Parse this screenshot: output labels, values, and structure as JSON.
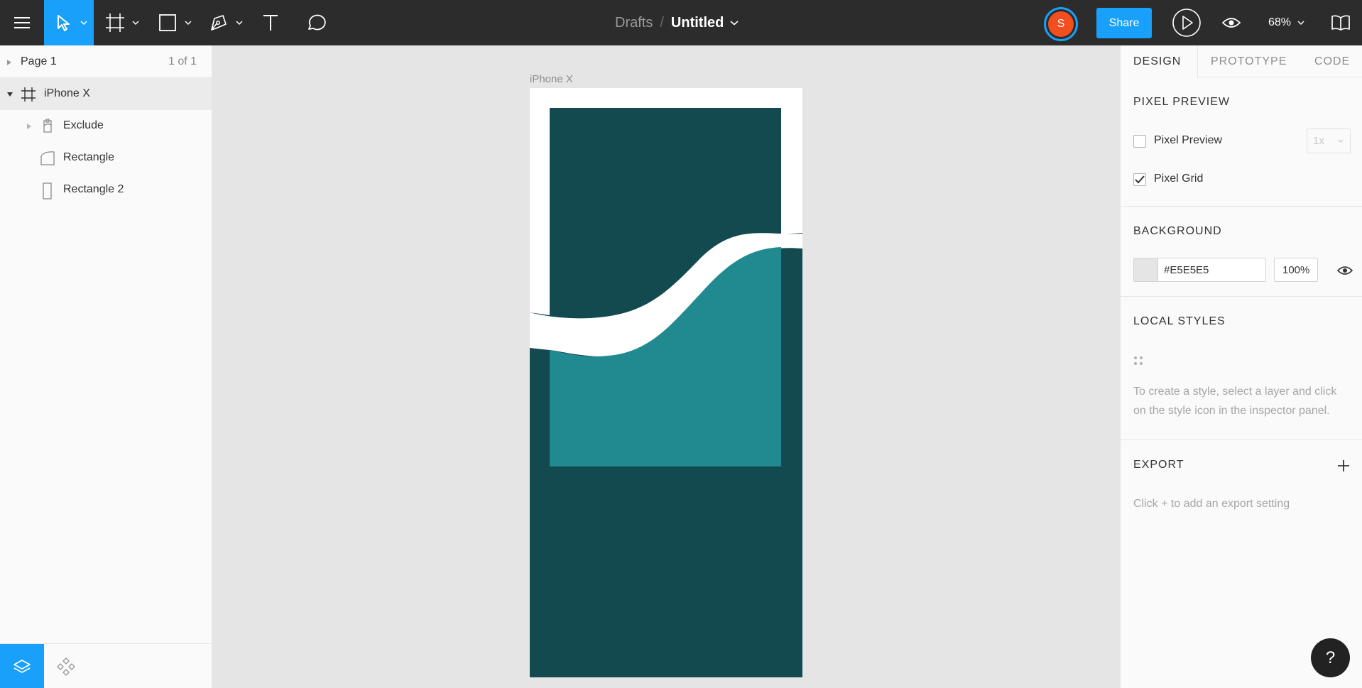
{
  "toolbar": {
    "breadcrumb_parent": "Drafts",
    "breadcrumb_separator": "/",
    "file_title": "Untitled",
    "avatar_initial": "S",
    "share_label": "Share",
    "zoom": "68%",
    "icons": [
      "menu-icon",
      "move-icon",
      "frame-icon",
      "rectangle-icon",
      "pen-icon",
      "text-icon",
      "comment-icon",
      "play-icon",
      "eye-icon",
      "library-icon"
    ]
  },
  "layers_panel": {
    "page_label": "Page 1",
    "page_count": "1 of 1",
    "layers": [
      {
        "label": "iPhone X",
        "icon": "frame-icon"
      },
      {
        "label": "Exclude",
        "icon": "boolean-icon"
      },
      {
        "label": "Rectangle",
        "icon": "vector-icon"
      },
      {
        "label": "Rectangle 2",
        "icon": "rectangle-icon"
      }
    ]
  },
  "canvas": {
    "frame_label": "iPhone X",
    "colors": {
      "dark_teal": "#124a4f",
      "teal": "#218a90",
      "white": "#ffffff"
    }
  },
  "inspector": {
    "tabs": [
      "DESIGN",
      "PROTOTYPE",
      "CODE"
    ],
    "pixel_preview": {
      "title": "PIXEL PREVIEW",
      "pixel_preview_label": "Pixel Preview",
      "pixel_preview_checked": false,
      "scale_value": "1x",
      "pixel_grid_label": "Pixel Grid",
      "pixel_grid_checked": true
    },
    "background": {
      "title": "BACKGROUND",
      "hex": "#E5E5E5",
      "opacity": "100%"
    },
    "local_styles": {
      "title": "LOCAL STYLES",
      "hint": "To create a style, select a layer and click on the style icon in the inspector panel."
    },
    "export": {
      "title": "EXPORT",
      "hint": "Click + to add an export setting"
    }
  },
  "help_label": "?",
  "accent_color": "#18a0fb"
}
